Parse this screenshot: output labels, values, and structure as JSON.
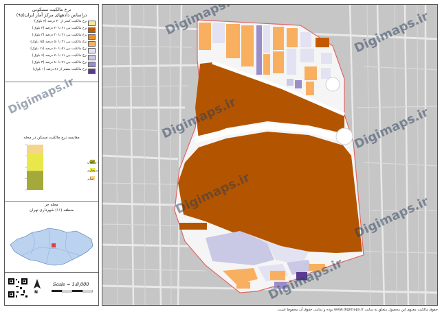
{
  "legend": {
    "title_line1": "نرخ مالکیت مسکونی",
    "title_line2": "دراساس دادههای مرکز آمار ایران(۹۵)",
    "classes": [
      {
        "label": "نرخ مالکیت کمتر از ۲۰ درصد (۳ بلوک)",
        "color": "#f6e79a"
      },
      {
        "label": "نرخ مالکیت بین ۲۱ تا ۳۰ درصد (۴ بلوک)",
        "color": "#c45a00"
      },
      {
        "label": "نرخ مالکیت بین ۳۱ تا ۴۰ درصد (۳ بلوک)",
        "color": "#e8902a"
      },
      {
        "label": "نرخ مالکیت بین ۴۱ تا ۵۰ درصد (۱۵ بلوک)",
        "color": "#f8b060"
      },
      {
        "label": "نرخ مالکیت بین ۵۱ تا ۶۰ درصد (۱۱ بلوک)",
        "color": "#e2e2f2"
      },
      {
        "label": "نرخ مالکیت بین ۶۱ تا ۷۰ درصد (۶ بلوک)",
        "color": "#c9c9e6"
      },
      {
        "label": "نرخ مالکیت بین ۷۱ تا ۸۰ درصد (۴ بلوک)",
        "color": "#9a8ec8"
      },
      {
        "label": "نرخ مالکیت بیشتر از ۸۱ درصد (۱ بلوک)",
        "color": "#5b3a8f"
      }
    ]
  },
  "bar_chart": {
    "title": "مقایسه نرخ مالکیت مسکن در محله",
    "categories": [
      {
        "label": "مالک عرصه و اعیان",
        "color": "#a5a83a"
      },
      {
        "label": "رهن استیجاری",
        "color": "#e9e84a"
      },
      {
        "label": "سایر",
        "color": "#f6d48a"
      }
    ],
    "chart_data": {
      "type": "bar",
      "orientation": "stacked-vertical",
      "categories": [
        "مالک عرصه و اعیان",
        "رهن استیجاری",
        "سایر"
      ],
      "values": [
        42,
        38,
        20
      ]
    }
  },
  "location": {
    "neighborhood": "محله حر",
    "district": "منطقه (۱۱) شهرداری تهران"
  },
  "scale_text": "Scale = 1:8,000",
  "north_letter": "N",
  "watermarks": [
    "Digimaps.ir",
    "Digimaps.ir",
    "Digimaps.ir",
    "Digimaps.ir",
    "Digimaps.ir",
    "Digimaps.ir",
    "Digimaps.ir"
  ],
  "footer_text": "حقوق مالکیت معنوی این محصول متعلق به سایت www.digimaps.ir بوده و تمامی حقوق آن محفوظ است.",
  "colors": {
    "main_block": "#b35500",
    "boundary": "#e06666",
    "road": "#ffffff",
    "background_map": "#c9c9c9"
  }
}
